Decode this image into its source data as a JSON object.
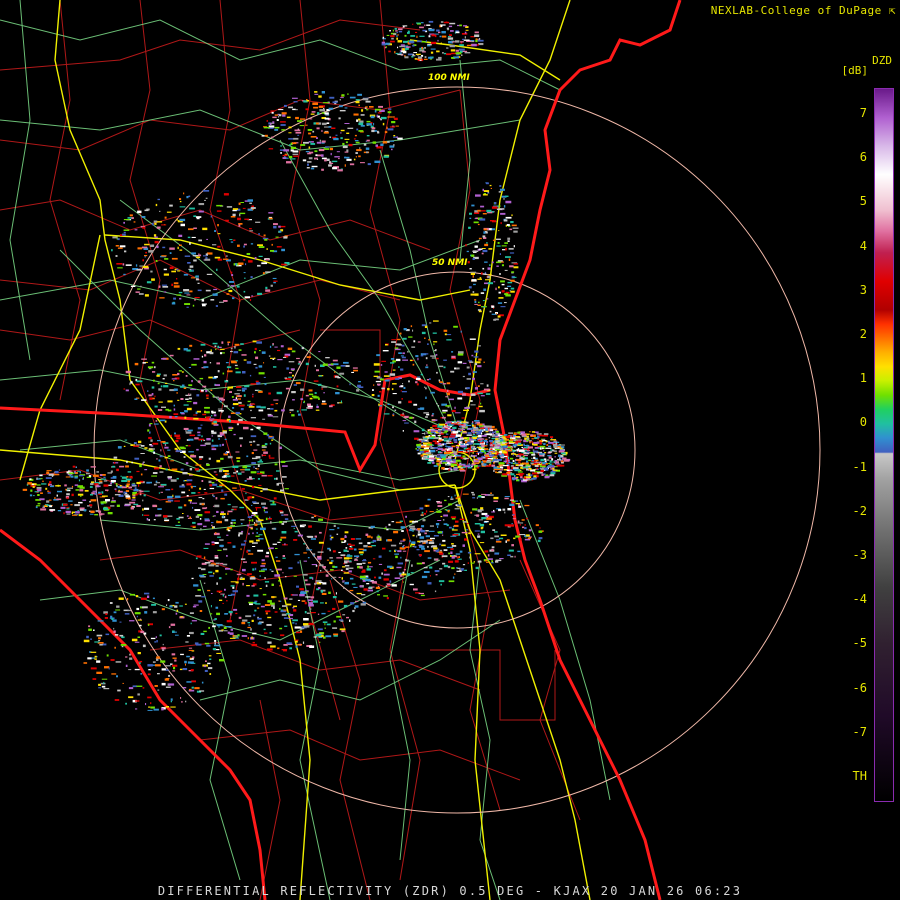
{
  "header": {
    "credit": "NEXLAB-College of DuPage"
  },
  "footer": {
    "product_line": "DIFFERENTIAL REFLECTIVITY (ZDR) 0.5 DEG - KJAX 20 JAN 26 06:23"
  },
  "range_rings": {
    "labels": [
      "100 NMI",
      "50 NMI"
    ]
  },
  "legend": {
    "product": "DZD",
    "units": "[dB]",
    "ticks": [
      "7",
      "6",
      "5",
      "4",
      "3",
      "2",
      "1",
      "0",
      "-1",
      "-2",
      "-3",
      "-4",
      "-5",
      "-6",
      "-7",
      "TH"
    ]
  },
  "colors": {
    "state_border": "#ff1a1a",
    "county_border": "#b01818",
    "highway": "#f0f000",
    "road": "#7ee08a",
    "range_ring": "#f0b8a8",
    "label": "#e6e600"
  }
}
